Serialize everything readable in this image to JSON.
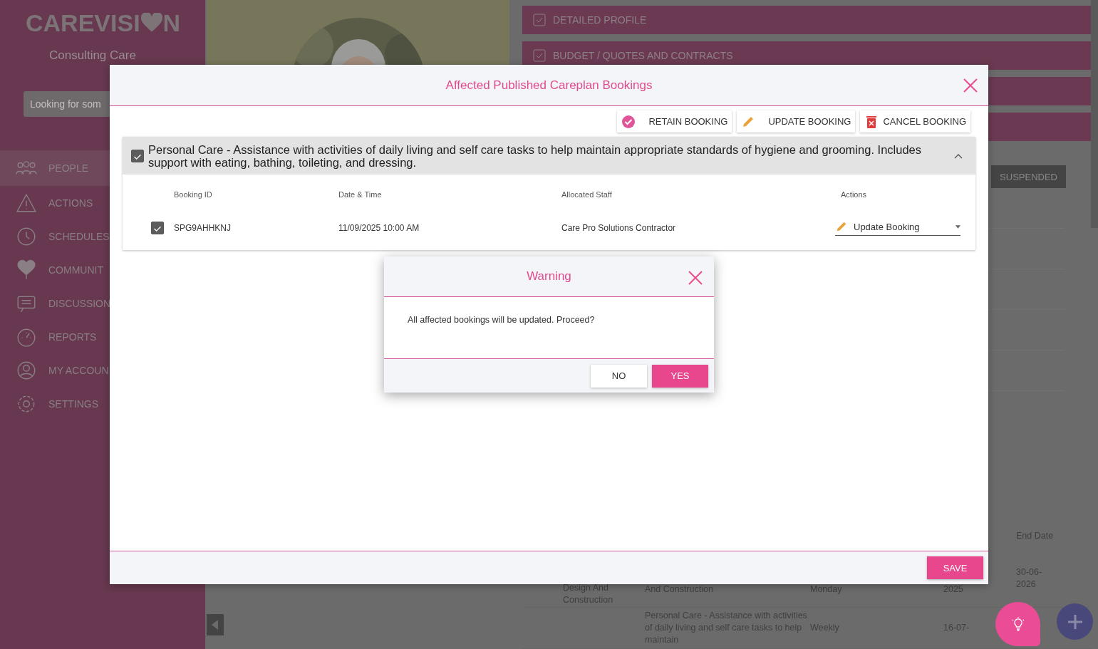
{
  "sidebar": {
    "logo_start": "CAREVISI",
    "logo_end": "N",
    "org": "Consulting Care",
    "search": {
      "placeholder": "Looking for som"
    },
    "items": [
      {
        "label": "PEOPLE",
        "kind": "people",
        "selected": true
      },
      {
        "label": "ACTIONS",
        "kind": "warning",
        "selected": false
      },
      {
        "label": "SCHEDULES",
        "kind": "clock",
        "selected": false
      },
      {
        "label": "COMMUNIT",
        "kind": "heart",
        "selected": false
      },
      {
        "label": "DISCUSSION",
        "kind": "chat",
        "selected": false
      },
      {
        "label": "REPORTS",
        "kind": "gauge",
        "selected": false
      },
      {
        "label": "MY ACCOUN",
        "kind": "user",
        "selected": false
      },
      {
        "label": "SETTINGS",
        "kind": "gear",
        "selected": false
      }
    ]
  },
  "sections": [
    {
      "label": "DETAILED PROFILE"
    },
    {
      "label": "BUDGET / QUOTES AND CONTRACTS"
    }
  ],
  "status_button": "SUSPENDED",
  "background_table": {
    "end_header": "End Date",
    "rows": [
      {
        "service": "Design And Construction",
        "description": "And Construction",
        "frequency": "Monday",
        "start": "2025",
        "end": "30-06-2026"
      },
      {
        "description": "Personal Care - Assistance with activities of daily living and self care tasks to help maintain",
        "frequency": "Weekly",
        "start": "16-07-"
      }
    ]
  },
  "dialog": {
    "title": "Affected Published Careplan Bookings",
    "actions": [
      {
        "label": "RETAIN BOOKING",
        "kind": "check"
      },
      {
        "label": "UPDATE BOOKING",
        "kind": "pencil"
      },
      {
        "label": "CANCEL BOOKING",
        "kind": "trash"
      }
    ],
    "group": {
      "checked": true,
      "expanded": true,
      "title": "Personal Care - Assistance with activities of daily living and self care tasks to help maintain appropriate standards of hygiene and grooming. Includes support with eating, bathing, toileting, and dressing.",
      "columns": [
        "Booking ID",
        "Date & Time",
        "Allocated Staff",
        "Actions"
      ],
      "rows": [
        {
          "checked": true,
          "booking_id": "SPG9AHHKNJ",
          "date_time": "11/09/2025 10:00 AM",
          "staff": "Care Pro Solutions Contractor",
          "action": "Update Booking"
        }
      ]
    },
    "save": "SAVE"
  },
  "warning": {
    "title": "Warning",
    "message": "All affected bookings will be updated. Proceed?",
    "buttons": [
      {
        "label": "NO",
        "kind": "secondary"
      },
      {
        "label": "YES",
        "kind": "primary"
      }
    ]
  }
}
